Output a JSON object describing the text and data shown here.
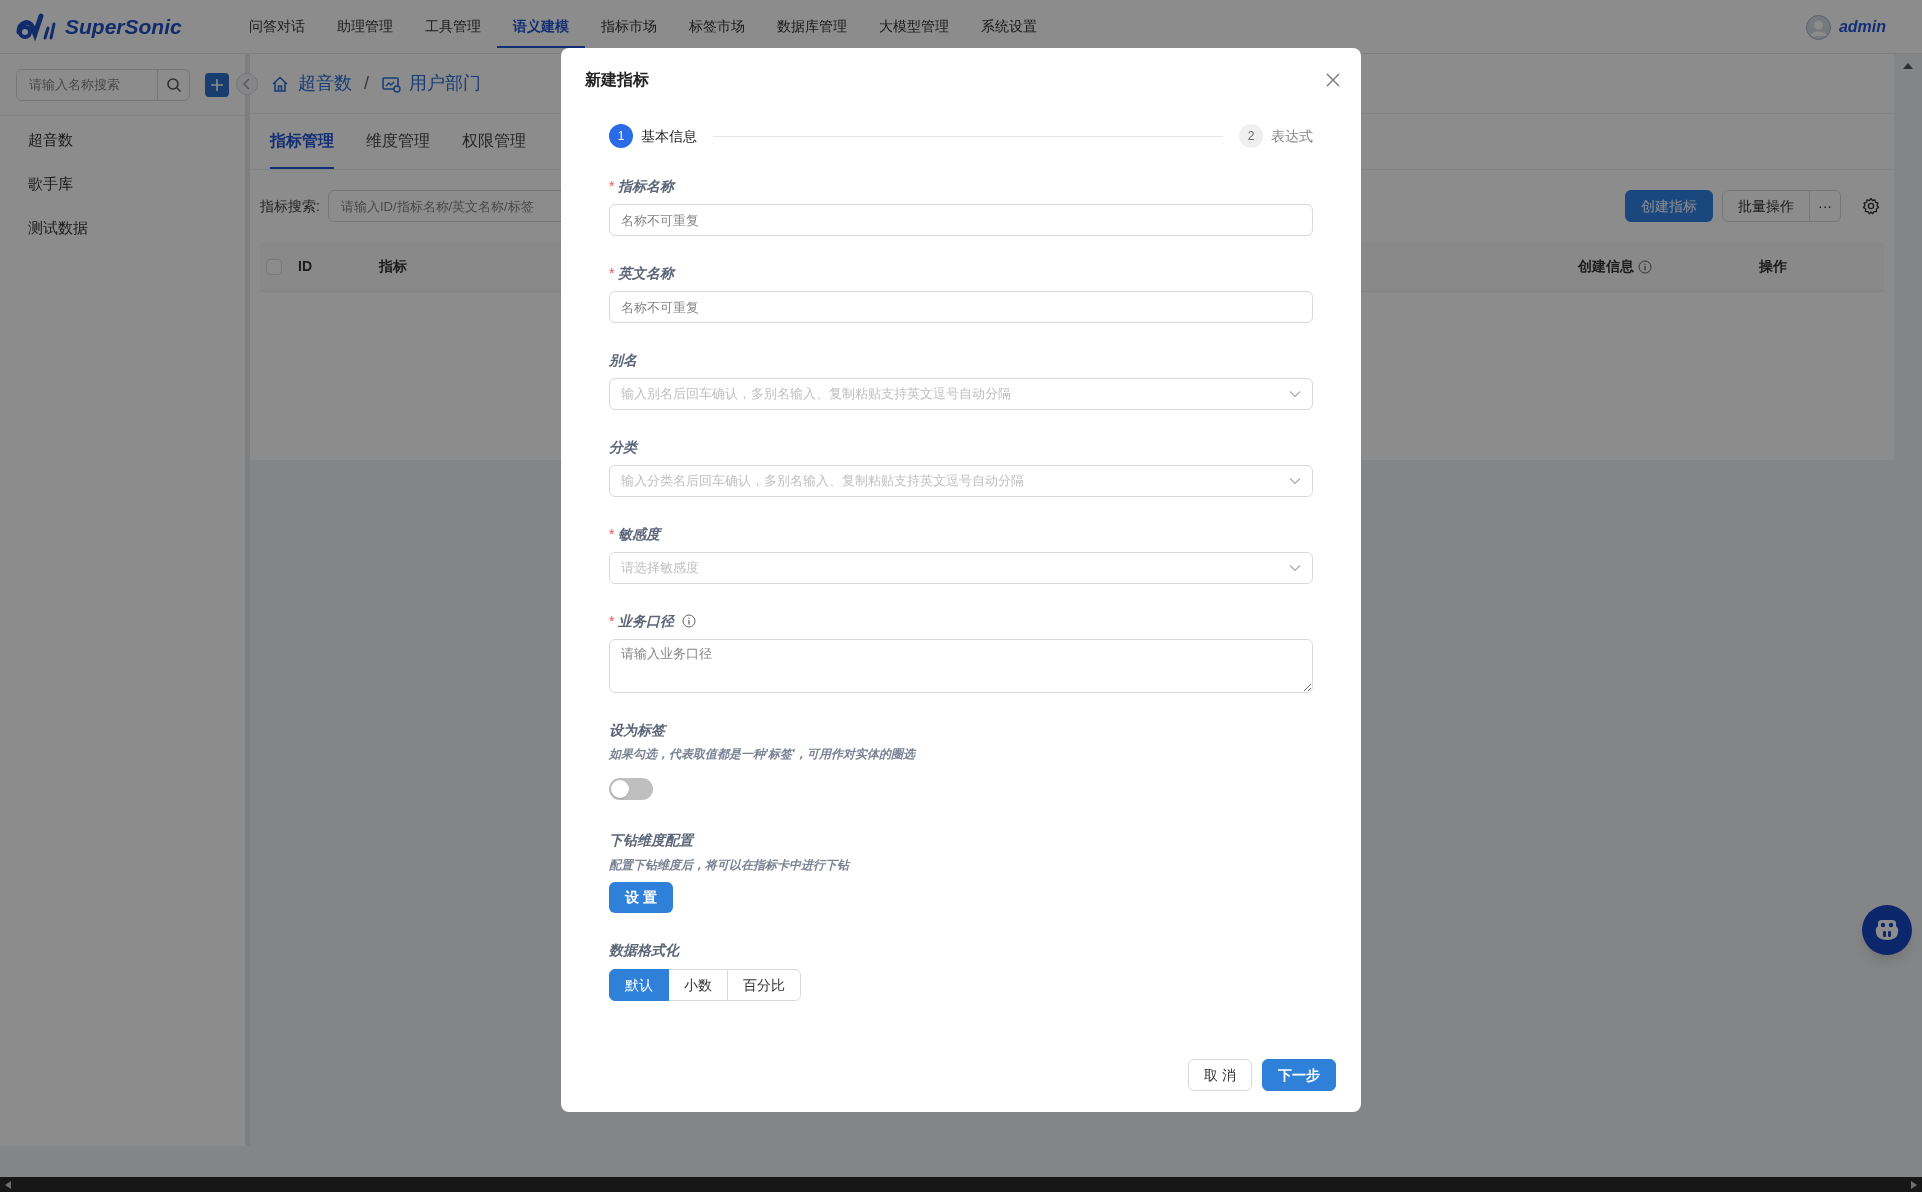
{
  "header": {
    "logo_text": "SuperSonic",
    "user": "admin",
    "nav": [
      {
        "label": "问答对话",
        "selected": false
      },
      {
        "label": "助理管理",
        "selected": false
      },
      {
        "label": "工具管理",
        "selected": false
      },
      {
        "label": "语义建模",
        "selected": true
      },
      {
        "label": "指标市场",
        "selected": false
      },
      {
        "label": "标签市场",
        "selected": false
      },
      {
        "label": "数据库管理",
        "selected": false
      },
      {
        "label": "大模型管理",
        "selected": false
      },
      {
        "label": "系统设置",
        "selected": false
      }
    ]
  },
  "sidebar": {
    "search_placeholder": "请输入名称搜索",
    "items": [
      "超音数",
      "歌手库",
      "测试数据"
    ]
  },
  "breadcrumb": {
    "separator": "/",
    "items": [
      {
        "kind": "home",
        "label": "超音数"
      },
      {
        "kind": "model",
        "label": "用户部门"
      }
    ]
  },
  "tabs": [
    {
      "label": "指标管理",
      "selected": true
    },
    {
      "label": "维度管理",
      "selected": false
    },
    {
      "label": "权限管理",
      "selected": false
    }
  ],
  "search": {
    "label": "指标搜索:",
    "placeholder": "请输入ID/指标名称/英文名称/标签"
  },
  "toolbar": {
    "create": "创建指标",
    "batch": "批量操作",
    "more": "···"
  },
  "table": {
    "select_all_checked": false,
    "columns": [
      {
        "label": "ID",
        "info_icon": false
      },
      {
        "label": "指标",
        "info_icon": false
      },
      {
        "label": "创建信息",
        "info_icon": true
      },
      {
        "label": "操作",
        "info_icon": false
      }
    ]
  },
  "modal": {
    "title": "新建指标",
    "steps": [
      {
        "number": "1",
        "label": "基本信息",
        "current": true
      },
      {
        "number": "2",
        "label": "表达式",
        "current": false
      }
    ],
    "fields": [
      {
        "kind": "input",
        "required_mark": "*",
        "label": "指标名称",
        "info_icon": false,
        "placeholder": "名称不可重复"
      },
      {
        "kind": "input",
        "required_mark": "*",
        "label": "英文名称",
        "info_icon": false,
        "placeholder": "名称不可重复"
      },
      {
        "kind": "select",
        "label": "别名",
        "info_icon": false,
        "placeholder": "输入别名后回车确认，多别名输入、复制粘贴支持英文逗号自动分隔"
      },
      {
        "kind": "select",
        "label": "分类",
        "info_icon": false,
        "placeholder": "输入分类名后回车确认，多别名输入、复制粘贴支持英文逗号自动分隔"
      },
      {
        "kind": "select",
        "required_mark": "*",
        "label": "敏感度",
        "info_icon": false,
        "placeholder": "请选择敏感度"
      },
      {
        "kind": "textarea",
        "required_mark": "*",
        "label": "业务口径",
        "info_icon": true,
        "placeholder": "请输入业务口径"
      }
    ],
    "tag_setting": {
      "label": "设为标签",
      "hint": "如果勾选，代表取值都是一种'标签'，可用作对实体的圈选",
      "on": false
    },
    "drill_down": {
      "label": "下钻维度配置",
      "hint": "配置下钻维度后，将可以在指标卡中进行下钻",
      "button": "设 置"
    },
    "data_format": {
      "label": "数据格式化",
      "options": [
        {
          "label": "默认",
          "selected": true
        },
        {
          "label": "小数",
          "selected": false
        },
        {
          "label": "百分比",
          "selected": false
        }
      ]
    },
    "footer": [
      {
        "kind": "default",
        "label": "取 消"
      },
      {
        "kind": "primary",
        "label": "下一步"
      }
    ]
  }
}
